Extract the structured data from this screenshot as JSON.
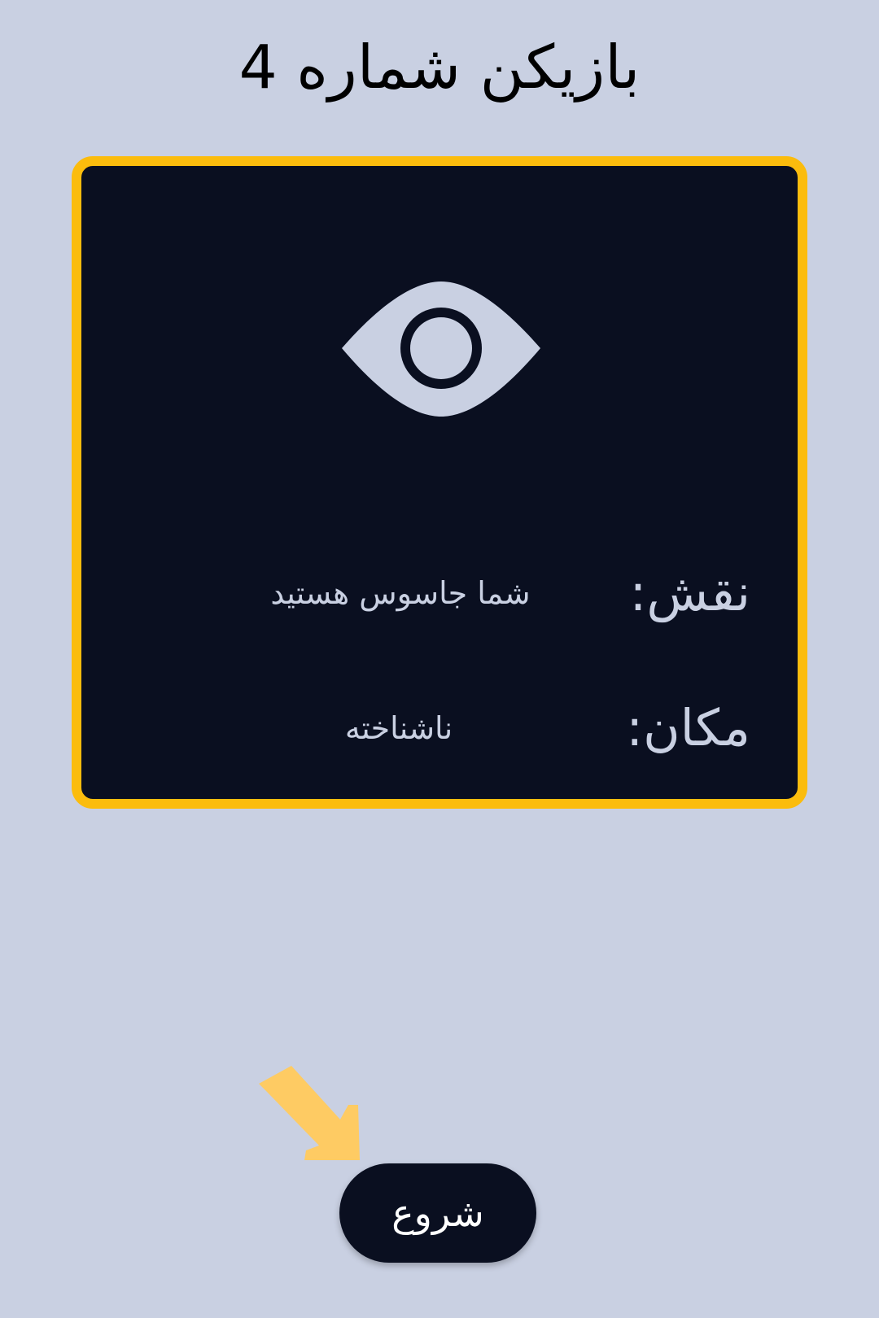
{
  "header": {
    "title": "بازیکن شماره 4"
  },
  "card": {
    "icon": "eye-icon",
    "role": {
      "label": "نقش:",
      "value": "شما جاسوس هستید"
    },
    "place": {
      "label": "مکان:",
      "value": "ناشناخته"
    }
  },
  "actions": {
    "start_label": "شروع",
    "hint_icon": "arrow-pointer-icon"
  },
  "colors": {
    "background": "#c9d0e2",
    "card": "#0a0f20",
    "accent": "#fbbc0d",
    "arrow": "#fecb63",
    "text_light": "#c9d0e2"
  }
}
